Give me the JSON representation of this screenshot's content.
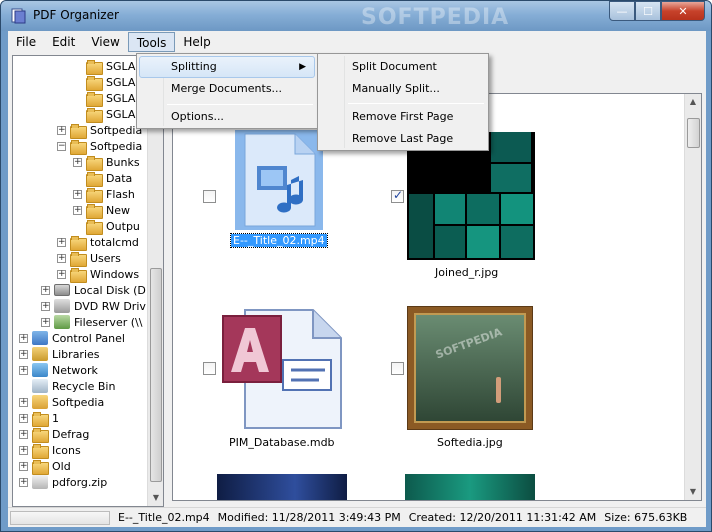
{
  "window": {
    "title": "PDF Organizer",
    "watermark": "SOFTPEDIA",
    "controls": {
      "minimize": "—",
      "maximize": "☐",
      "close": "✕"
    }
  },
  "menubar": {
    "items": [
      {
        "label": "File"
      },
      {
        "label": "Edit"
      },
      {
        "label": "View"
      },
      {
        "label": "Tools",
        "active": true
      },
      {
        "label": "Help"
      }
    ]
  },
  "tools_menu": {
    "items": [
      {
        "label": "Splitting",
        "has_submenu": true,
        "highlighted": true
      },
      {
        "label": "Merge Documents..."
      },
      {
        "label": "Options..."
      }
    ]
  },
  "splitting_submenu": {
    "items": [
      {
        "label": "Split Document"
      },
      {
        "label": "Manually Split..."
      },
      {
        "label": "Remove First Page"
      },
      {
        "label": "Remove Last Page"
      }
    ]
  },
  "tree": {
    "items": [
      {
        "label": "SGLAB3",
        "icon": "folder-icon"
      },
      {
        "label": "SGLAB3",
        "icon": "folder-icon"
      },
      {
        "label": "SGLAB3",
        "icon": "folder-icon"
      },
      {
        "label": "SGLAB3",
        "icon": "folder-icon"
      },
      {
        "label": "Softpedia",
        "icon": "folder-icon",
        "expander": "+"
      },
      {
        "label": "Softpedia",
        "icon": "folder-icon",
        "expander": "−"
      },
      {
        "label": "Bunks",
        "icon": "folder-icon",
        "expander": "+"
      },
      {
        "label": "Data",
        "icon": "folder-icon"
      },
      {
        "label": "Flash",
        "icon": "folder-icon",
        "expander": "+"
      },
      {
        "label": "New",
        "icon": "folder-icon",
        "expander": "+"
      },
      {
        "label": "Outpu",
        "icon": "folder-icon"
      },
      {
        "label": "totalcmd",
        "icon": "folder-icon",
        "expander": "+"
      },
      {
        "label": "Users",
        "icon": "folder-icon",
        "expander": "+"
      },
      {
        "label": "Windows",
        "icon": "folder-icon",
        "expander": "+"
      },
      {
        "label": "Local Disk (D",
        "icon": "drive-icon",
        "expander": "+"
      },
      {
        "label": "DVD RW Driv",
        "icon": "dvd-icon",
        "expander": "+"
      },
      {
        "label": "Fileserver (\\\\",
        "icon": "network-drive-icon",
        "expander": "+"
      },
      {
        "label": "Control Panel",
        "icon": "control-panel-icon",
        "expander": "+"
      },
      {
        "label": "Libraries",
        "icon": "libraries-icon",
        "expander": "+"
      },
      {
        "label": "Network",
        "icon": "network-icon",
        "expander": "+"
      },
      {
        "label": "Recycle Bin",
        "icon": "recycle-bin-icon"
      },
      {
        "label": "Softpedia",
        "icon": "user-folder-icon",
        "expander": "+"
      },
      {
        "label": "1",
        "icon": "folder-icon",
        "expander": "+"
      },
      {
        "label": "Defrag",
        "icon": "folder-icon",
        "expander": "+"
      },
      {
        "label": "Icons",
        "icon": "folder-icon",
        "expander": "+"
      },
      {
        "label": "Old",
        "icon": "folder-icon",
        "expander": "+"
      },
      {
        "label": "pdforg.zip",
        "icon": "zip-icon",
        "expander": "+"
      }
    ]
  },
  "thumbnails": {
    "items": [
      {
        "label": "E--_Title_02.mp4",
        "checked": false,
        "selected": true,
        "icon": "video-file-icon"
      },
      {
        "label": "Joined_r.jpg",
        "checked": true,
        "selected": false,
        "icon": "image-thumbnail"
      },
      {
        "label": "PIM_Database.mdb",
        "checked": false,
        "selected": false,
        "icon": "access-file-icon"
      },
      {
        "label": "Softedia.jpg",
        "checked": false,
        "selected": false,
        "icon": "image-thumbnail"
      },
      {
        "label": "",
        "icon": "image-thumbnail"
      },
      {
        "label": "",
        "icon": "image-thumbnail"
      }
    ],
    "preview_watermark": "SOFTPEDIA"
  },
  "status": {
    "file": "E--_Title_02.mp4",
    "modified": "Modified: 11/28/2011 3:49:43 PM",
    "created": "Created: 12/20/2011 11:31:42 AM",
    "size": "Size: 675.63KB"
  },
  "colors": {
    "selection": "#3399ff",
    "title_gradient_top": "#a9c6e3",
    "folder": "#e0a836"
  }
}
